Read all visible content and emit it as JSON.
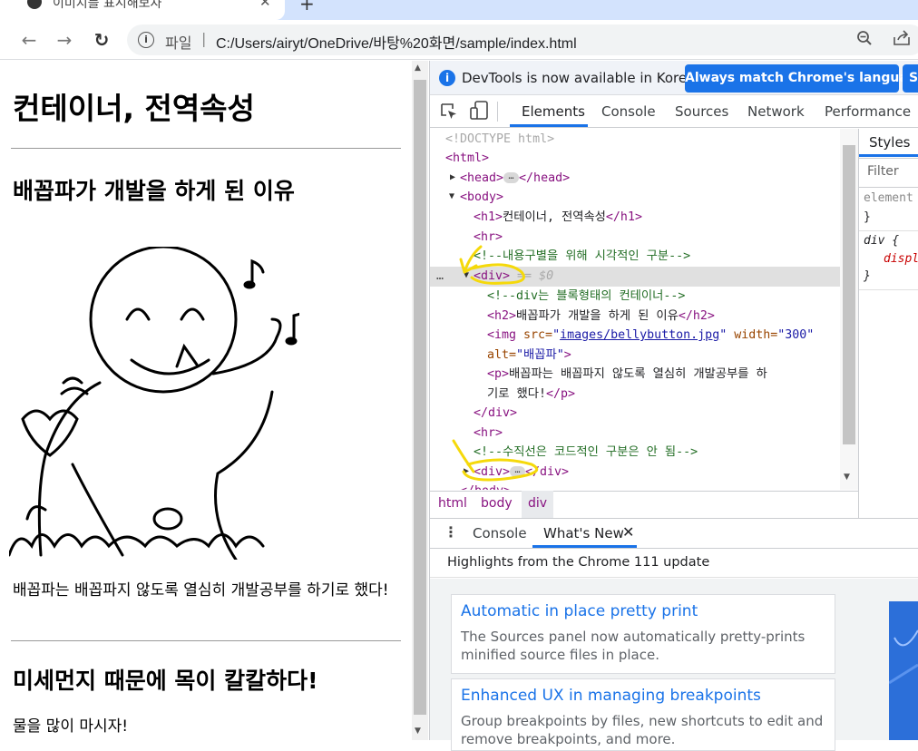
{
  "browser": {
    "tab_title": "이미지를 표시해보자",
    "tab_close": "✕",
    "new_tab": "+",
    "back": "←",
    "forward": "→",
    "reload": "↻",
    "scheme_label": "파일",
    "url_separator": "|",
    "url": "C:/Users/airyt/OneDrive/바탕%20화면/sample/index.html",
    "icons": [
      "info-icon",
      "zoom-icon",
      "share-icon"
    ]
  },
  "page": {
    "h1": "컨테이너, 전역속성",
    "section1_title": "배꼽파가 개발을 하게 된 이유",
    "section1_image_alt": "배꼽파",
    "section1_text": "배꼽파는 배꼽파지 않도록 열심히 개발공부를 하기로 했다!",
    "section2_title": "미세먼지 때문에 목이 칼칼하다!",
    "section2_text": "물을 많이 마시자!"
  },
  "devtools": {
    "infobar_text": "DevTools is now available in Korean!",
    "match_button": "Always match Chrome's language",
    "switch_button": "Sw",
    "tabs": [
      "Elements",
      "Console",
      "Sources",
      "Network",
      "Performance"
    ],
    "dom": {
      "doctype": "<!DOCTYPE html>",
      "html_open": "<html>",
      "head_open": "<head>",
      "head_close": "</head>",
      "body_open": "<body>",
      "h1_open": "<h1>",
      "h1_text": "컨테이너, 전역속성",
      "h1_close": "</h1>",
      "hr": "<hr>",
      "comment1": "<!--내용구별을 위해 시각적인 구분-->",
      "div_open": "<div>",
      "selected_marker": "== $0",
      "comment2": "<!--div는 블록형태의 컨테이너-->",
      "h2_open": "<h2>",
      "h2_text": "배꼽파가 개발을 하게 된 이유",
      "h2_close": "</h2>",
      "img_open": "<img ",
      "src_attr": "src=",
      "src_value": "images/bellybutton.jpg",
      "width_attr": "width=",
      "width_value": "\"300\"",
      "alt_attr": "alt=",
      "alt_value": "\"배꼽파\"",
      "img_close": ">",
      "p_open": "<p>",
      "p_text_1": "배꼽파는 배꼽파지 않도록 열심히 개발공부를 하",
      "p_text_2": "기로 했다!",
      "p_close": "</p>",
      "div_close": "</div>",
      "hr2": "<hr>",
      "comment3": "<!--수직선은 코드적인 구분은 안 됨-->",
      "div2_open": "<div>",
      "div2_close": "</div>",
      "body_close": "</body>",
      "ellipsis": "…",
      "row_ellipsis": "…"
    },
    "breadcrumbs": [
      "html",
      "body",
      "div"
    ],
    "styles": {
      "tab": "Styles",
      "filter_placeholder": "Filter",
      "rule1_selector": "element",
      "rule1_close": "}",
      "rule2_selector": "div {",
      "rule2_prop": "displ",
      "rule2_close": "}"
    },
    "drawer": {
      "menu": "⋮",
      "tabs": [
        "Console",
        "What's New"
      ],
      "close": "✕",
      "highlights": "Highlights from the Chrome 111 update",
      "cards": [
        {
          "title": "Automatic in place pretty print",
          "desc": "The Sources panel now automatically pretty-prints minified source files in place."
        },
        {
          "title": "Enhanced UX in managing breakpoints",
          "desc": "Group breakpoints by files, new shortcuts to edit and remove breakpoints, and more."
        }
      ]
    }
  },
  "colors": {
    "accent": "#1a73e8",
    "tag": "#881280",
    "comment": "#236e25",
    "annotation": "#f5d90a"
  }
}
